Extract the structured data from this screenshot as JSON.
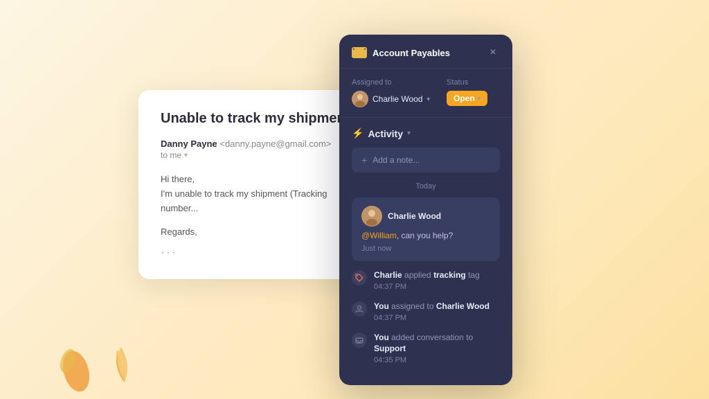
{
  "background": "#fde8b8",
  "email_card": {
    "subject": "Unable to track my shipment",
    "from_name": "Danny Payne",
    "from_email": "<danny.payne@gmail.com>",
    "to_label": "to me",
    "body_line1": "Hi there,",
    "body_line2": "I'm unable to track my shipment (Tracking number...",
    "regards": "Regards,",
    "more_icon": "···"
  },
  "panel": {
    "icon_label": "envelope-icon",
    "title": "Account Payables",
    "close_label": "×",
    "assigned_label": "Assigned to",
    "assigned_name": "Charlie Wood",
    "status_label": "Status",
    "status_value": "Open",
    "activity_label": "Activity",
    "add_note_placeholder": "Add a note...",
    "today_label": "Today",
    "message": {
      "author": "Charlie Wood",
      "mention": "@William",
      "text": ", can you help?",
      "time": "Just now"
    },
    "log_items": [
      {
        "icon": "tag-icon",
        "text_parts": [
          "Charlie",
          " applied ",
          "tracking",
          " tag"
        ],
        "bold_indices": [
          0,
          2
        ],
        "time": "04:37 PM"
      },
      {
        "icon": "user-icon",
        "text_parts": [
          "You",
          " assigned to ",
          "Charlie Wood"
        ],
        "bold_indices": [
          0,
          2
        ],
        "time": "04:37 PM"
      },
      {
        "icon": "inbox-icon",
        "text_parts": [
          "You",
          " added conversation to ",
          "Support"
        ],
        "bold_indices": [
          0,
          2
        ],
        "time": "04:35 PM"
      }
    ]
  }
}
